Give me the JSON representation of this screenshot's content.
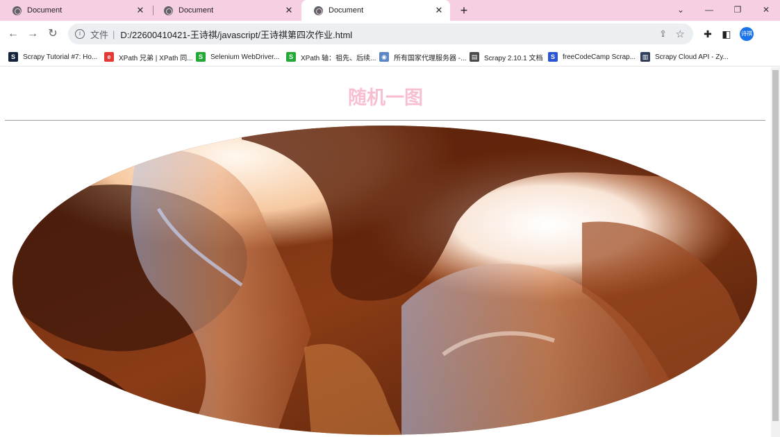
{
  "browser": {
    "tabs": [
      {
        "title": "Document",
        "close": "✕"
      },
      {
        "title": "Document",
        "close": "✕"
      },
      {
        "title": "Document",
        "close": "✕"
      }
    ],
    "new_tab": "+",
    "window_controls": {
      "chevron": "⌄",
      "minimize": "—",
      "restore": "❐",
      "close": "✕"
    }
  },
  "toolbar": {
    "back": "←",
    "forward": "→",
    "reload": "↻",
    "scheme_label": "文件",
    "url": "D:/22600410421-王诗祺/javascript/王诗祺第四次作业.html",
    "profile_initials": "诗祺"
  },
  "bookmarks": [
    {
      "label": "Scrapy Tutorial #7: Ho...",
      "icon": "scrapy-tutorial-icon",
      "color": "#14233c",
      "glyph": "S"
    },
    {
      "label": "XPath 兄弟 | XPath 同...",
      "icon": "xpath-brand-icon",
      "color": "#e53935",
      "glyph": "e"
    },
    {
      "label": "Selenium WebDriver...",
      "icon": "selenium-s-icon",
      "color": "#23a936",
      "glyph": "S"
    },
    {
      "label": "XPath 轴：祖先、后续...",
      "icon": "selenium-s-icon",
      "color": "#23a936",
      "glyph": "S"
    },
    {
      "label": "所有国家代理服务器 -...",
      "icon": "globe-icon",
      "color": "#5a86c4",
      "glyph": "◉"
    },
    {
      "label": "Scrapy 2.10.1 文档",
      "icon": "docs-icon",
      "color": "#4a4a4a",
      "glyph": "▤"
    },
    {
      "label": "freeCodeCamp Scrap...",
      "icon": "freecodecamp-icon",
      "color": "#2a56d6",
      "glyph": "S"
    },
    {
      "label": "Scrapy Cloud API - Zy...",
      "icon": "chart-icon",
      "color": "#2f3f5a",
      "glyph": "▥"
    }
  ],
  "page": {
    "title": "随机一图"
  }
}
